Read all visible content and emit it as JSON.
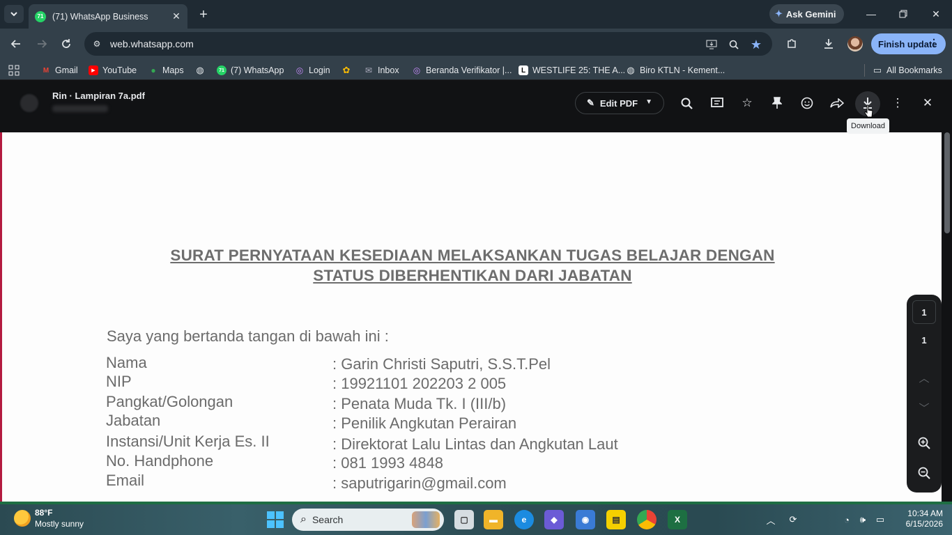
{
  "browser": {
    "tab": {
      "title": "(71) WhatsApp Business",
      "favicon_badge": "71"
    },
    "gemini_label": "Ask Gemini",
    "url": "web.whatsapp.com",
    "finish_update_label": "Finish update",
    "bookmarks": [
      {
        "label": "Gmail",
        "icon": "gmail-icon"
      },
      {
        "label": "YouTube",
        "icon": "youtube-icon"
      },
      {
        "label": "Maps",
        "icon": "maps-icon"
      },
      {
        "label": "",
        "icon": "globe-icon"
      },
      {
        "label": "(7) WhatsApp",
        "icon": "whatsapp-icon",
        "badge": "71"
      },
      {
        "label": "Login",
        "icon": "login-icon"
      },
      {
        "label": "",
        "icon": "pinwheel-icon"
      },
      {
        "label": "Inbox",
        "icon": "mail-icon"
      },
      {
        "label": "Beranda Verifikator |...",
        "icon": "verifier-icon"
      },
      {
        "label": "WESTLIFE 25: THE A...",
        "icon": "page-icon"
      },
      {
        "label": "Biro KTLN - Kement...",
        "icon": "globe-icon"
      }
    ],
    "all_bookmarks_label": "All Bookmarks"
  },
  "viewer": {
    "file_name": "Rin · Lampiran 7a.pdf",
    "edit_pdf_label": "Edit PDF",
    "tooltip": "Download",
    "page_current": "1",
    "page_total": "1"
  },
  "document": {
    "title_line1": "SURAT PERNYATAAN KESEDIAAN MELAKSANKAN TUGAS BELAJAR DENGAN",
    "title_line2": "STATUS DIBERHENTIKAN DARI JABATAN",
    "intro": "Saya yang bertanda tangan di bawah ini :",
    "fields": [
      {
        "label": "Nama",
        "value": ": Garin Christi Saputri, S.S.T.Pel"
      },
      {
        "label": "NIP",
        "value": ": 19921101 202203 2 005"
      },
      {
        "label": "Pangkat/Golongan",
        "value": ": Penata Muda Tk. I (III/b)"
      },
      {
        "label": "Jabatan",
        "value": ": Penilik Angkutan Perairan"
      },
      {
        "label": "Instansi/Unit Kerja Es. II",
        "value": ": Direktorat Lalu Lintas dan Angkutan Laut"
      },
      {
        "label": "No. Handphone",
        "value": ": 081 1993 4848"
      },
      {
        "label": "Email",
        "value": ": saputrigarin@gmail.com"
      }
    ]
  },
  "taskbar": {
    "weather_temp": "88°F",
    "weather_text": "Mostly sunny",
    "search_label": "Search",
    "time": "10:34 AM",
    "date": "6/15/2026"
  },
  "colors": {
    "accent": "#8ab4f8",
    "pdf_edge": "#b31b40",
    "whatsapp": "#25d366"
  }
}
